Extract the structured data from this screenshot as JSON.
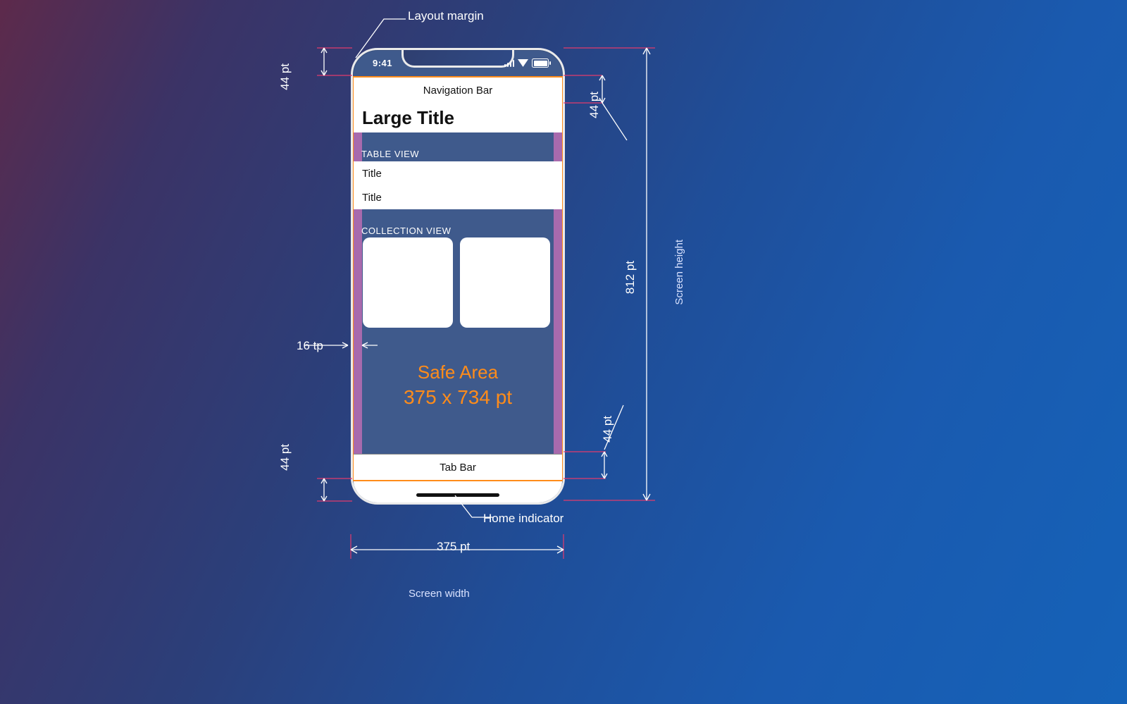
{
  "annotations": {
    "layout_margin": "Layout margin",
    "home_indicator": "Home indicator",
    "screen_width": "Screen width",
    "screen_height": "Screen height"
  },
  "dims": {
    "status_h": "44 pt",
    "nav_h": "44 pt",
    "tab_h": "44 pt",
    "home_h": "44 pt",
    "margin_w": "16 tp",
    "width": "375 pt",
    "height": "812 pt"
  },
  "phone": {
    "time": "9:41",
    "navbar": "Navigation Bar",
    "large_title": "Large Title",
    "table_header": "TABLE VIEW",
    "cell1": "Title",
    "cell2": "Title",
    "collection_header": "COLLECTION VIEW",
    "safe_area_l1": "Safe Area",
    "safe_area_l2": "375 x 734 pt",
    "tabbar": "Tab Bar"
  },
  "chart_data": {
    "type": "diagram",
    "device": "iPhone X",
    "screen": {
      "width_pt": 375,
      "height_pt": 812
    },
    "safe_area": {
      "width_pt": 375,
      "height_pt": 734
    },
    "status_bar_height_pt": 44,
    "navigation_bar_height_pt": 44,
    "tab_bar_height_pt": 44,
    "home_indicator_height_pt": 44,
    "layout_margin_pt": 16
  }
}
